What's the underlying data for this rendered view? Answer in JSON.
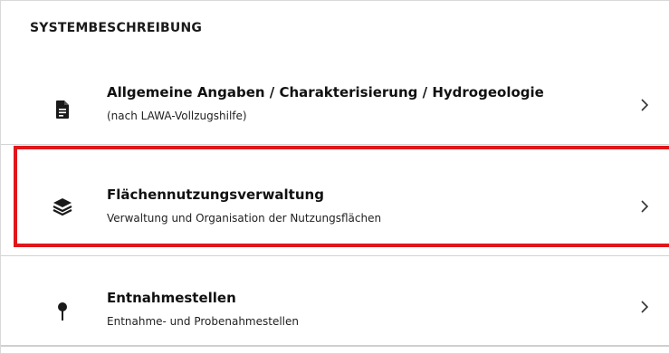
{
  "section": {
    "title": "SYSTEMBESCHREIBUNG"
  },
  "items": [
    {
      "title": "Allgemeine Angaben / Charakterisierung / Hydrogeologie",
      "subtitle": "(nach LAWA-Vollzugshilfe)",
      "icon": "document-icon",
      "chevron": "chevron-right-icon"
    },
    {
      "title": "Flächennutzungsverwaltung",
      "subtitle": "Verwaltung und Organisation der Nutzungsflächen",
      "icon": "layers-icon",
      "chevron": "chevron-right-icon",
      "highlighted": true,
      "highlight_color": "#e0161b"
    },
    {
      "title": "Entnahmestellen",
      "subtitle": "Entnahme- und Probenahmestellen",
      "icon": "map-pin-icon",
      "chevron": "chevron-right-icon"
    }
  ],
  "colors": {
    "text": "#111111",
    "divider": "#d3d3d3",
    "highlight": "#e0161b"
  }
}
